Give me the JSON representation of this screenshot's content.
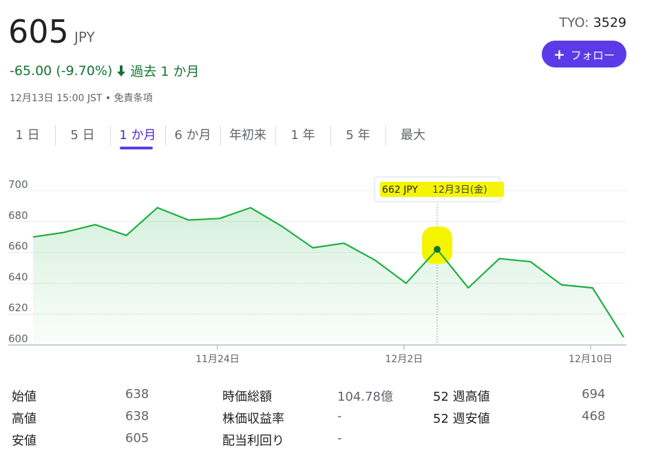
{
  "quote": {
    "price": "605",
    "currency": "JPY",
    "change": "-65.00 (-9.70%)",
    "period": "過去 1 か月",
    "timestamp": "12月13日 15:00 JST • 免責条項",
    "exchange_label": "TYO: ",
    "symbol": "3529",
    "follow_label": "フォロー"
  },
  "tabs": [
    {
      "label": "1 日"
    },
    {
      "label": "5 日"
    },
    {
      "label": "1 か月",
      "active": true
    },
    {
      "label": "6 か月"
    },
    {
      "label": "年初来"
    },
    {
      "label": "1 年"
    },
    {
      "label": "5 年"
    },
    {
      "label": "最大"
    }
  ],
  "tooltip": {
    "price": "662 JPY",
    "date": "12月3日(金)"
  },
  "chart_data": {
    "type": "area",
    "ylim": [
      600,
      700
    ],
    "yticks": [
      "700",
      "680",
      "660",
      "640",
      "620",
      "600"
    ],
    "xticks": [
      "11月24日",
      "12月2日",
      "12月10日"
    ],
    "values": [
      670,
      673,
      678,
      671,
      689,
      681,
      682,
      689,
      677,
      663,
      666,
      655,
      640,
      662,
      637,
      656,
      654,
      639,
      637,
      605
    ],
    "highlight_index": 13,
    "line_color": "#1aae3f",
    "grid": true
  },
  "stats": [
    {
      "label": "始値",
      "value": "638"
    },
    {
      "label": "高値",
      "value": "638"
    },
    {
      "label": "安値",
      "value": "605"
    },
    {
      "label": "時価総額",
      "value": "104.78億"
    },
    {
      "label": "株価収益率",
      "value": "-"
    },
    {
      "label": "配当利回り",
      "value": "-"
    },
    {
      "label": "52 週高値",
      "value": "694"
    },
    {
      "label": "52 週安値",
      "value": "468"
    }
  ]
}
